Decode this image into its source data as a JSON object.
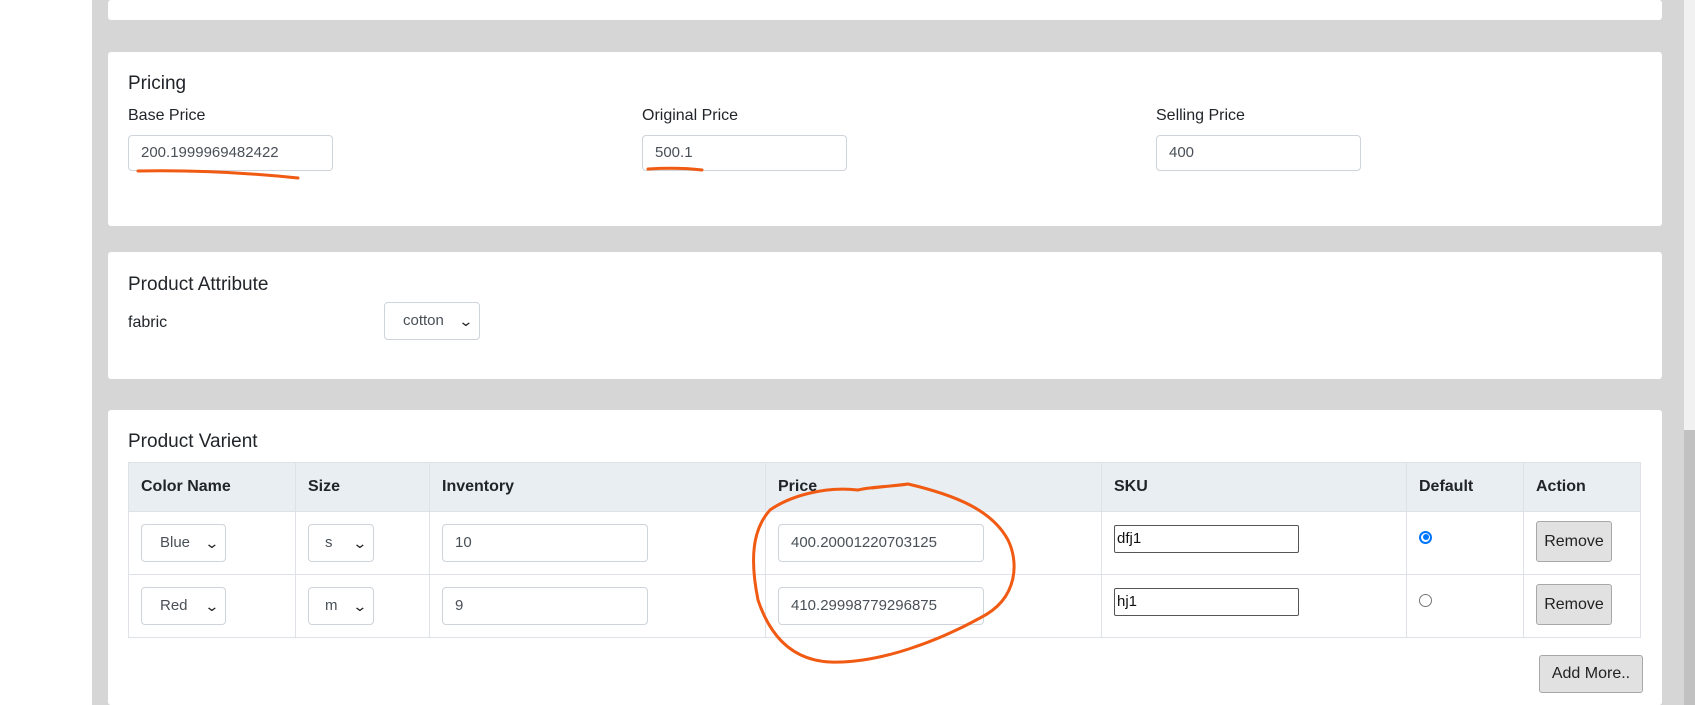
{
  "pricing": {
    "title": "Pricing",
    "base_price": {
      "label": "Base Price",
      "value": "200.1999969482422"
    },
    "original_price": {
      "label": "Original Price",
      "value": "500.1"
    },
    "selling_price": {
      "label": "Selling Price",
      "value": "400"
    }
  },
  "attribute": {
    "title": "Product Attribute",
    "name": "fabric",
    "value": "cotton"
  },
  "variant": {
    "title": "Product Varient",
    "columns": [
      "Color Name",
      "Size",
      "Inventory",
      "Price",
      "SKU",
      "Default",
      "Action"
    ],
    "rows": [
      {
        "color": "Blue",
        "size": "s",
        "inventory": "10",
        "price": "400.20001220703125",
        "sku": "dfj1",
        "default": true,
        "action": "Remove"
      },
      {
        "color": "Red",
        "size": "m",
        "inventory": "9",
        "price": "410.29998779296875",
        "sku": "hj1",
        "default": false,
        "action": "Remove"
      }
    ],
    "add_more_label": "Add More.."
  },
  "annotation_color": "#f05a12",
  "icons": {
    "dropdown": "chevron-down-icon"
  }
}
